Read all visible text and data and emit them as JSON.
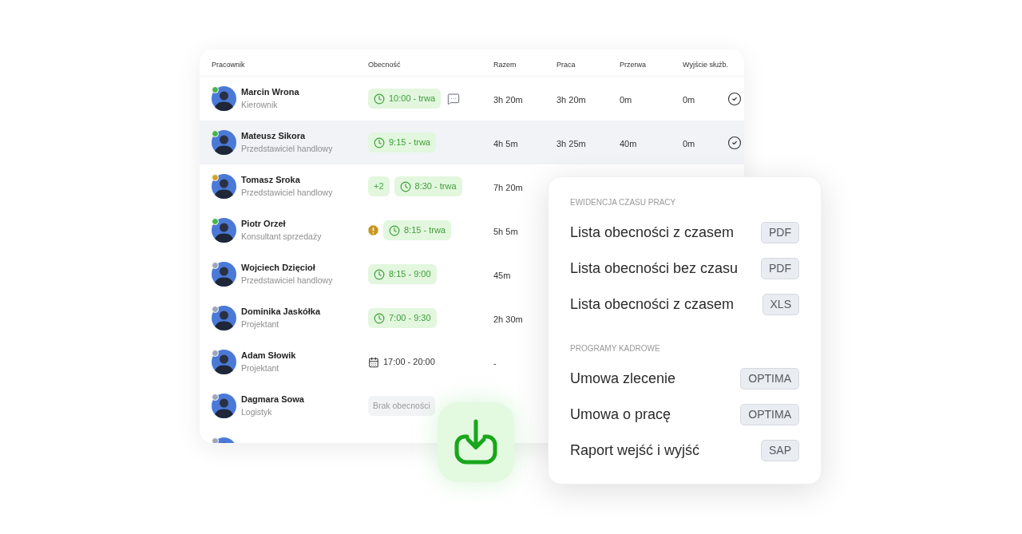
{
  "table": {
    "columns": [
      "Pracownik",
      "Obecność",
      "Razem",
      "Praca",
      "Przerwa",
      "Wyjście służb."
    ],
    "rows": [
      {
        "name": "Marcin Wrona",
        "role": "Kierownik",
        "color": "#46b54b",
        "selected": false,
        "presence": [
          {
            "kind": "shift",
            "text": "10:00 - trwa"
          },
          {
            "kind": "comment"
          }
        ],
        "total": "3h 20m",
        "work": "3h 20m",
        "break": "0m",
        "business_exit": "0m",
        "confirmed": true
      },
      {
        "name": "Mateusz Sikora",
        "role": "Przedstawiciel handlowy",
        "color": "#46b54b",
        "selected": true,
        "presence": [
          {
            "kind": "shift",
            "text": "9:15 - trwa"
          }
        ],
        "total": "4h 5m",
        "work": "3h 25m",
        "break": "40m",
        "business_exit": "0m",
        "confirmed": true
      },
      {
        "name": "Tomasz Sroka",
        "role": "Przedstawiciel handlowy",
        "color": "#d6a228",
        "selected": false,
        "presence": [
          {
            "kind": "count",
            "text": "+2"
          },
          {
            "kind": "shift",
            "text": "8:30 - trwa"
          }
        ],
        "total": "7h 20m"
      },
      {
        "name": "Piotr Orzeł",
        "role": "Konsultant sprzedaży",
        "color": "#46b54b",
        "selected": false,
        "presence": [
          {
            "kind": "warning"
          },
          {
            "kind": "shift",
            "text": "8:15 - trwa"
          }
        ],
        "total": "5h 5m"
      },
      {
        "name": "Wojciech Dzięcioł",
        "role": "Przedstawiciel handlowy",
        "color": "#9ea5b9",
        "selected": false,
        "presence": [
          {
            "kind": "shift",
            "text": "8:15 - 9:00"
          }
        ],
        "total": "45m"
      },
      {
        "name": "Dominika Jaskółka",
        "role": "Projektant",
        "color": "#9ea5b9",
        "selected": false,
        "presence": [
          {
            "kind": "shift",
            "text": "7:00 - 9:30"
          }
        ],
        "total": "2h 30m"
      },
      {
        "name": "Adam Słowik",
        "role": "Projektant",
        "color": "#9ea5b9",
        "selected": false,
        "presence": [
          {
            "kind": "planned",
            "text": "17:00 - 20:00"
          }
        ],
        "total": "-"
      },
      {
        "name": "Dagmara Sowa",
        "role": "Logistyk",
        "color": "#9ea5b9",
        "selected": false,
        "presence": [
          {
            "kind": "absent",
            "text": "Brak obecności"
          }
        ]
      },
      {
        "color": "#9ea5b9",
        "selected": false
      }
    ]
  },
  "export_panel": {
    "sections": [
      {
        "heading": "EWIDENCJA CZASU PRACY",
        "items": [
          {
            "label": "Lista obecności z czasem",
            "format": "PDF"
          },
          {
            "label": "Lista obecności bez czasu",
            "format": "PDF"
          },
          {
            "label": "Lista obecności z czasem",
            "format": "XLS"
          }
        ]
      },
      {
        "heading": "PROGRAMY KADROWE",
        "items": [
          {
            "label": "Umowa zlecenie",
            "format": "OPTIMA"
          },
          {
            "label": "Umowa o pracę",
            "format": "OPTIMA"
          },
          {
            "label": "Raport wejść i wyjść",
            "format": "SAP"
          }
        ]
      }
    ]
  }
}
